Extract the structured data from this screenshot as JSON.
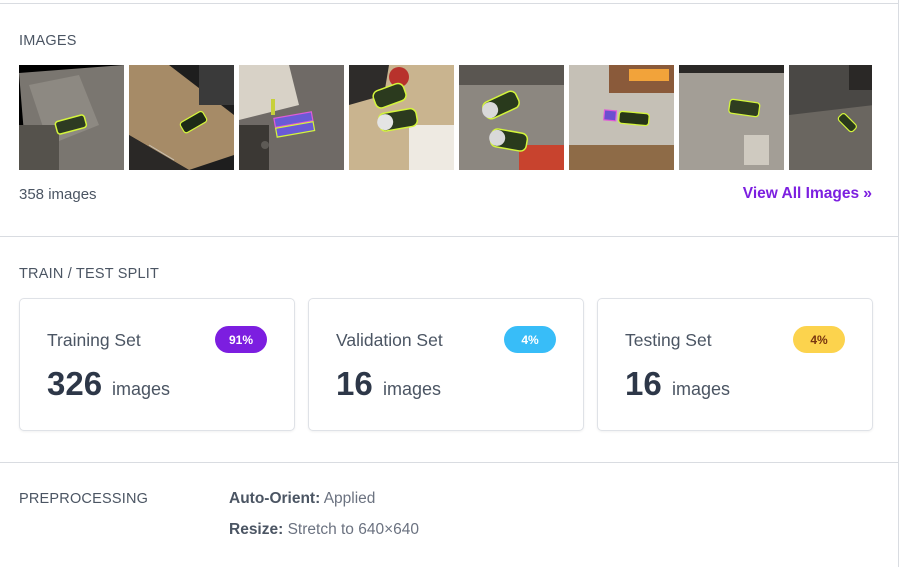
{
  "images": {
    "heading": "IMAGES",
    "count_text": "358 images",
    "view_all_label": "View All Images",
    "thumbnails": [
      {
        "name": "thumbnail-1"
      },
      {
        "name": "thumbnail-2"
      },
      {
        "name": "thumbnail-3"
      },
      {
        "name": "thumbnail-4"
      },
      {
        "name": "thumbnail-5"
      },
      {
        "name": "thumbnail-6"
      },
      {
        "name": "thumbnail-7"
      },
      {
        "name": "thumbnail-8"
      }
    ]
  },
  "split": {
    "heading": "TRAIN / TEST SPLIT",
    "cards": [
      {
        "title": "Training Set",
        "badge": "91%",
        "count": "326",
        "unit": "images",
        "badge_bg": "#7c1ee0",
        "badge_fg": "#ffffff"
      },
      {
        "title": "Validation Set",
        "badge": "4%",
        "count": "16",
        "unit": "images",
        "badge_bg": "#38bdf8",
        "badge_fg": "#ffffff"
      },
      {
        "title": "Testing Set",
        "badge": "4%",
        "count": "16",
        "unit": "images",
        "badge_bg": "#fcd34d",
        "badge_fg": "#78350f"
      }
    ]
  },
  "preprocessing": {
    "heading": "PREPROCESSING",
    "items": [
      {
        "label": "Auto-Orient:",
        "value": "Applied"
      },
      {
        "label": "Resize:",
        "value": "Stretch to 640×640"
      }
    ]
  },
  "colors": {
    "accent": "#7c1fe0",
    "annotation": "#d4f53c"
  }
}
